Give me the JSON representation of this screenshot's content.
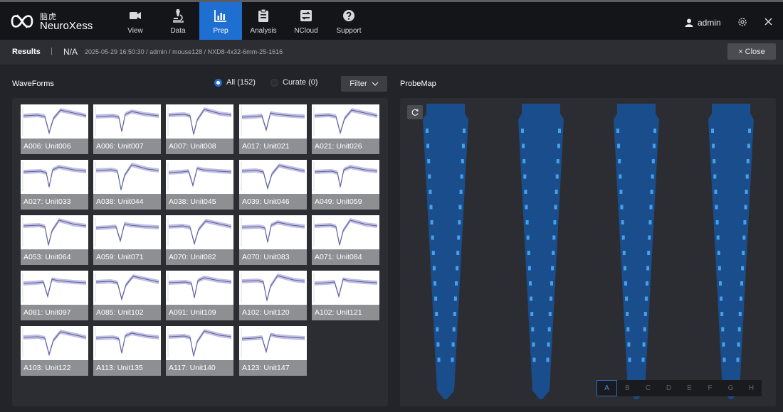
{
  "brand": {
    "cn": "脑虎",
    "en": "NeuroXess"
  },
  "nav": [
    {
      "id": "view",
      "label": "View",
      "icon": "video-camera-icon",
      "active": false
    },
    {
      "id": "data",
      "label": "Data",
      "icon": "microscope-icon",
      "active": false
    },
    {
      "id": "prep",
      "label": "Prep",
      "icon": "bar-chart-icon",
      "active": true
    },
    {
      "id": "analysis",
      "label": "Analysis",
      "icon": "clipboard-icon",
      "active": false
    },
    {
      "id": "ncloud",
      "label": "NCloud",
      "icon": "transfer-icon",
      "active": false
    },
    {
      "id": "support",
      "label": "Support",
      "icon": "help-icon",
      "active": false
    }
  ],
  "user": {
    "name": "admin",
    "icon": "user-icon"
  },
  "results": {
    "title": "Results",
    "separator": "|",
    "na": "N/A",
    "path": "2025-05-29 16:50:30 / admin / mouse128 / NXD8-4x32-6mm-25-1616",
    "close_label": "× Close"
  },
  "waveforms": {
    "title": "WaveForms",
    "radio_all": "All (152)",
    "radio_curate": "Curate (0)",
    "filter_label": "Filter",
    "units": [
      "A006: Unit006",
      "A006: Unit007",
      "A007: Unit008",
      "A017: Unit021",
      "A021: Unit026",
      "A027: Unit033",
      "A038: Unit044",
      "A038: Unit045",
      "A039: Unit046",
      "A049: Unit059",
      "A053: Unit064",
      "A059: Unit071",
      "A070: Unit082",
      "A070: Unit083",
      "A071: Unit084",
      "A081: Unit097",
      "A085: Unit102",
      "A091: Unit109",
      "A102: Unit120",
      "A102: Unit121",
      "A103: Unit122",
      "A113: Unit135",
      "A117: Unit140",
      "A123: Unit147"
    ]
  },
  "probemap": {
    "title": "ProbeMap",
    "shank_color": "#1a4d8c",
    "contact_color": "#4aa0e8",
    "banks": [
      "A",
      "B",
      "C",
      "D",
      "E",
      "F",
      "G",
      "H"
    ],
    "active_bank": "A"
  },
  "colors": {
    "accent": "#1f6fd1",
    "waveform": "#5b5f9c",
    "waveform_band": "#b7b5de"
  }
}
